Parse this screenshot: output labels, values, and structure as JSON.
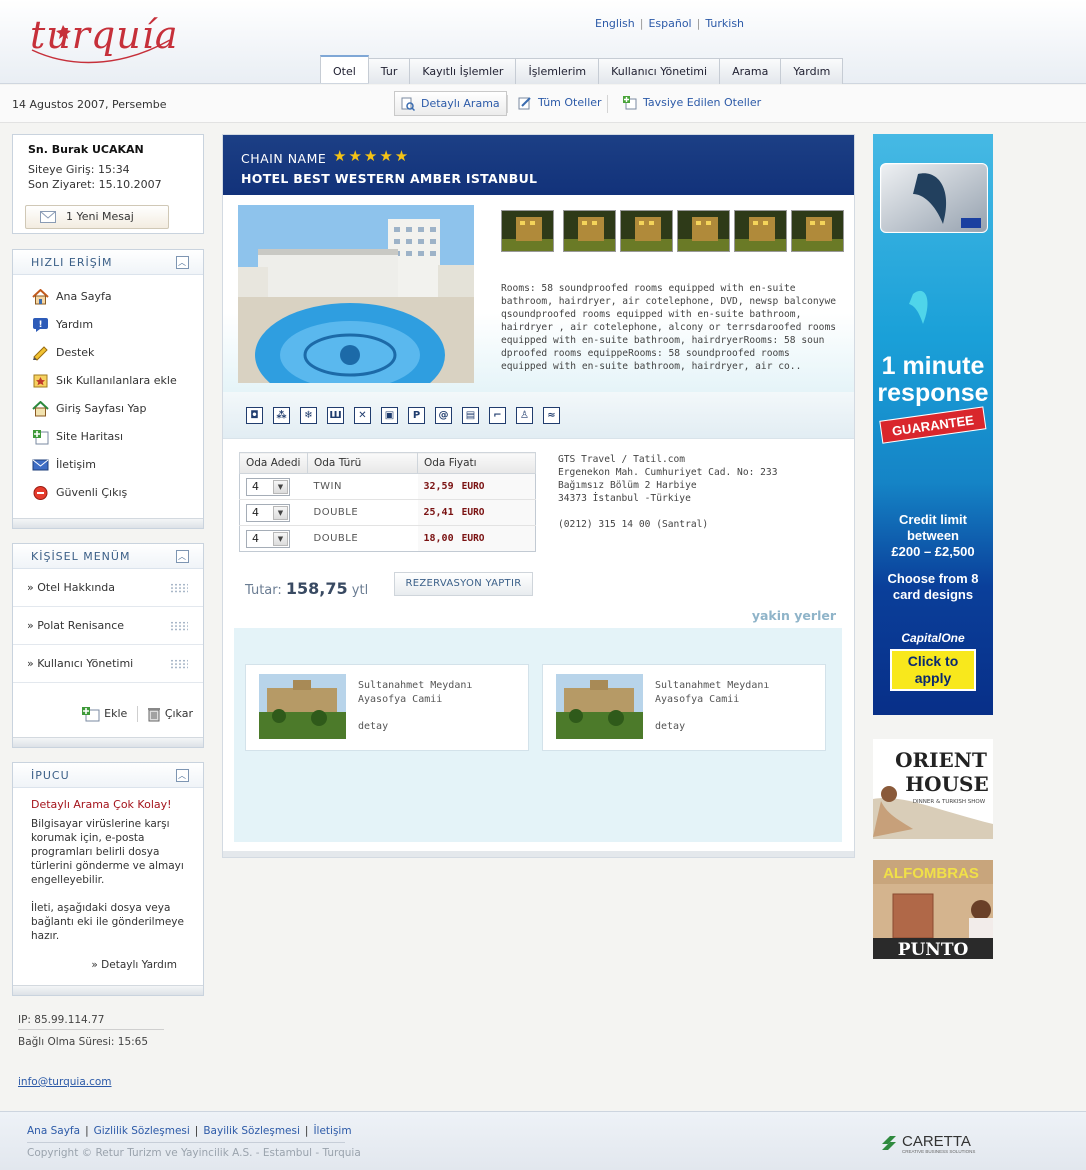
{
  "header": {
    "logo_text": "turquia",
    "languages": [
      "English",
      "Español",
      "Turkish"
    ],
    "tabs": [
      "Otel",
      "Tur",
      "Kayıtlı İşlemler",
      "İşlemlerim",
      "Kullanıcı Yönetimi",
      "Arama",
      "Yardım"
    ],
    "active_tab": "Otel"
  },
  "subbar": {
    "date": "14 Agustos 2007, Persembe",
    "buttons": [
      "Detaylı Arama",
      "Tüm Oteller",
      "Tavsiye Edilen Oteller"
    ]
  },
  "user": {
    "name": "Sn. Burak UCAKAN",
    "login": "Siteye Giriş:  15:34",
    "last_visit": "Son Ziyaret: 15.10.2007",
    "message_button": "1 Yeni Mesaj"
  },
  "quick_access": {
    "title": "HIZLI ERİŞİM",
    "items": [
      {
        "label": "Ana Sayfa",
        "icon": "home-icon"
      },
      {
        "label": "Yardım",
        "icon": "help-icon"
      },
      {
        "label": "Destek",
        "icon": "support-icon"
      },
      {
        "label": "Sık Kullanılanlara ekle",
        "icon": "favorites-icon"
      },
      {
        "label": "Giriş Sayfası Yap",
        "icon": "homepage-icon"
      },
      {
        "label": "Site Haritası",
        "icon": "sitemap-icon"
      },
      {
        "label": "İletişim",
        "icon": "mail-icon"
      },
      {
        "label": "Güvenli Çıkış",
        "icon": "logout-icon"
      }
    ]
  },
  "personal_menu": {
    "title": "KİŞİSEL MENÜM",
    "items": [
      "» Otel Hakkında",
      "» Polat Renisance",
      "» Kullanıcı Yönetimi"
    ],
    "add_label": "Ekle",
    "remove_label": "Çıkar"
  },
  "tip": {
    "title": "İPUCU",
    "headline": "Detaylı Arama Çok Kolay!",
    "paragraph1": "Bilgisayar virüslerine karşı korumak için, e-posta programları belirli dosya türlerini gönderme ve almayı engelleyebilir.",
    "paragraph2": "İleti, aşağıdaki dosya veya bağlantı eki ile gönderilmeye hazır.",
    "more": "» Detaylı Yardım"
  },
  "session": {
    "ip": "IP: 85.99.114.77",
    "connected": "Bağlı Olma Süresi: 15:65",
    "email": "info@turquia.com"
  },
  "hotel": {
    "chain": "CHAIN NAME",
    "stars": "★★★★★",
    "name": "HOTEL BEST WESTERN AMBER ISTANBUL",
    "description": "Rooms: 58 soundproofed rooms equipped with en-suite bathroom, hairdryer, air cotelephone, DVD, newsp balconywe qsoundproofed rooms equipped with en-suite bathroom, hairdryer , air cotelephone, alcony or terrsdaroofed rooms equipped with en-suite bathroom, hairdryerRooms: 58 soun dproofed rooms equippeRooms: 58 soundproofed rooms equipped with en-suite bathroom, hairdryer, air co..",
    "amenities": [
      "photo-icon",
      "kids-icon",
      "snowflake-icon",
      "heating-icon",
      "restaurant-icon",
      "tv-icon",
      "parking-icon",
      "internet-icon",
      "minibar-icon",
      "bath-icon",
      "roomservice-icon",
      "pool-icon"
    ],
    "amenity_glyphs": [
      "◘",
      "⁂",
      "❄",
      "Ш",
      "✕",
      "▣",
      "P",
      "@",
      "▤",
      "⌐",
      "♙",
      "≈"
    ],
    "room_table": {
      "headers": [
        "Oda Adedi",
        "Oda Türü",
        "Oda Fiyatı"
      ],
      "rows": [
        {
          "qty": "4",
          "type": "TWIN",
          "price": "32,59",
          "currency": "EURO"
        },
        {
          "qty": "4",
          "type": "DOUBLE",
          "price": "25,41",
          "currency": "EURO"
        },
        {
          "qty": "4",
          "type": "DOUBLE",
          "price": "18,00",
          "currency": "EURO"
        }
      ]
    },
    "address": {
      "line1": "GTS Travel / Tatil.com",
      "line2": "Ergenekon Mah. Cumhuriyet Cad. No: 233",
      "line3": "Bağımsız Bölüm 2 Harbiye",
      "line4": "34373 İstanbul -Türkiye",
      "phone": "(0212) 315 14 00 (Santral)"
    },
    "total_label": "Tutar:",
    "total_value": "158,75",
    "total_unit": "ytl",
    "reserve_button": "REZERVASYON YAPTIR",
    "nearby_title": "yakin yerler",
    "nearby": [
      {
        "line1": "Sultanahmet Meydanı",
        "line2": "Ayasofya Camii",
        "more": "detay"
      },
      {
        "line1": "Sultanahmet Meydanı",
        "line2": "Ayasofya Camii",
        "more": "detay"
      }
    ]
  },
  "ads": {
    "ad1": {
      "headline1": "1 minute",
      "headline2": "response",
      "stamp": "GUARANTEE",
      "credit1": "Credit limit",
      "credit2": "between",
      "credit3": "£200 – £2,500",
      "choose1": "Choose from 8",
      "choose2": "card designs",
      "brand": "CapitalOne",
      "cta1": "Click to",
      "cta2": "apply"
    },
    "ad2": {
      "title1": "ORIENT",
      "title2": "HOUSE",
      "sub": "DINNER & TURKISH SHOW"
    },
    "ad3": {
      "title1": "ALFOMBRAS",
      "title2": "PUNTO"
    }
  },
  "footer": {
    "links": [
      "Ana Sayfa",
      "Gizlilik Sözleşmesi",
      "Bayilik Sözleşmesi",
      "İletişim"
    ],
    "copyright": "Copyright © Retur Turizm ve Yayincilik A.S. - Estambul - Turquia",
    "brand": "CARETTA",
    "brand_tag": "CREATIVE BUSINESS SOLUTIONS"
  }
}
